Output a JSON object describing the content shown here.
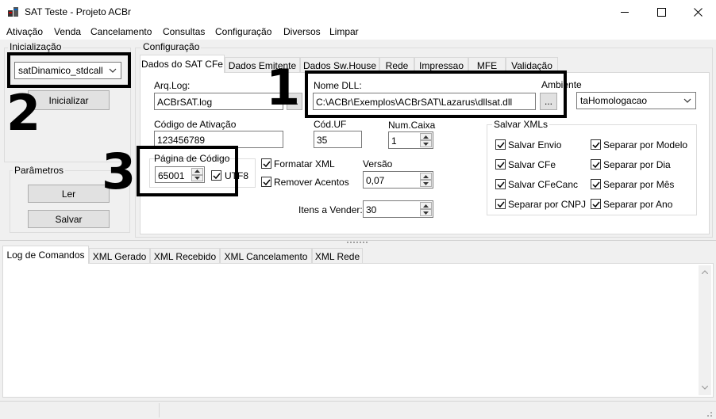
{
  "window": {
    "title": "SAT Teste - Projeto ACBr",
    "minimize_glyph": "—",
    "maximize_glyph": "☐",
    "close_glyph": "✕"
  },
  "menu": [
    "Ativação",
    "Venda",
    "Cancelamento",
    "Consultas",
    "Configuração",
    "Diversos",
    "Limpar"
  ],
  "init": {
    "group_label": "Inicialização",
    "library_combo": "satDinamico_stdcall",
    "init_button": "Inicializar"
  },
  "params": {
    "group_label": "Parâmetros",
    "read_button": "Ler",
    "save_button": "Salvar"
  },
  "config": {
    "group_label": "Configuração",
    "tabs": [
      "Dados do SAT CFe",
      "Dados Emitente",
      "Dados Sw.House",
      "Rede",
      "Impressao",
      "MFE",
      "Validação"
    ],
    "arq_log_label": "Arq.Log:",
    "arq_log_value": "ACBrSAT.log",
    "browse_button": "...",
    "nome_dll_label": "Nome DLL:",
    "nome_dll_value": "C:\\ACBr\\Exemplos\\ACBrSAT\\Lazarus\\dllsat.dll",
    "ambiente_label": "Ambiente",
    "ambiente_value": "taHomologacao",
    "codigo_ativacao_label": "Código de Ativação",
    "codigo_ativacao_value": "123456789",
    "cod_uf_label": "Cód.UF",
    "cod_uf_value": "35",
    "num_caixa_label": "Num.Caixa",
    "num_caixa_value": "1",
    "pagina_codigo_label": "Página de Código",
    "pagina_codigo_value": "65001",
    "utf8_label": "UTF8",
    "formatar_xml_label": "Formatar XML",
    "remover_acentos_label": "Remover Acentos",
    "versao_label": "Versão",
    "versao_value": "0,07",
    "itens_vender_label": "Itens a Vender:",
    "itens_vender_value": "30",
    "salvar_xmls": {
      "label": "Salvar XMLs",
      "options": [
        "Salvar Envio",
        "Salvar CFe",
        "Salvar CFeCanc",
        "Separar por CNPJ",
        "Separar por Modelo",
        "Separar por Dia",
        "Separar por Mês",
        "Separar por Ano"
      ]
    }
  },
  "bottom_tabs": [
    "Log de Comandos",
    "XML Gerado",
    "XML Recebido",
    "XML Cancelamento",
    "XML Rede"
  ],
  "callouts": [
    "1",
    "2",
    "3"
  ]
}
